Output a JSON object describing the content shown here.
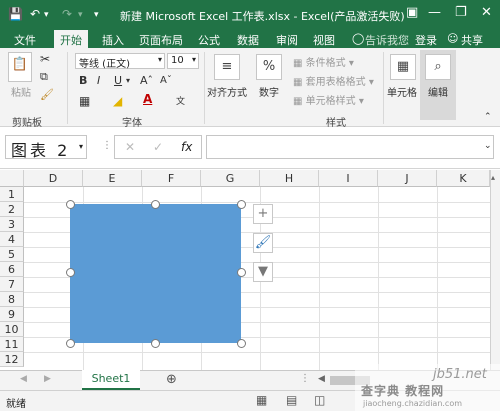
{
  "titlebar": {
    "title": "新建 Microsoft Excel 工作表.xlsx - Excel(产品激活失败)",
    "save_icon": "save-icon",
    "undo_icon": "undo-icon",
    "redo_icon": "redo-icon"
  },
  "tabs": {
    "file": "文件",
    "home": "开始",
    "insert": "插入",
    "page_layout": "页面布局",
    "formulas": "公式",
    "data": "数据",
    "review": "审阅",
    "view": "视图",
    "tell_me": "告诉我您",
    "login": "登录",
    "share": "共享"
  },
  "ribbon": {
    "paste_label": "粘贴",
    "clipboard_group": "剪贴板",
    "font_name": "等线 (正文)",
    "font_size": "10",
    "bold": "B",
    "italic": "I",
    "underline": "U",
    "font_group": "字体",
    "alignment_label": "对齐方式",
    "number_label": "数字",
    "conditional_format": "条件格式",
    "table_format": "套用表格格式",
    "cell_styles": "单元格样式",
    "styles_group": "样式",
    "cells_label": "单元格",
    "editing_label": "编辑"
  },
  "formula_bar": {
    "name_box": "图表 2",
    "fx": "fx",
    "formula_value": ""
  },
  "grid": {
    "columns": [
      "D",
      "E",
      "F",
      "G",
      "H",
      "I",
      "J",
      "K"
    ],
    "rows": [
      "1",
      "2",
      "3",
      "4",
      "5",
      "6",
      "7",
      "8",
      "9",
      "10",
      "11",
      "12"
    ]
  },
  "chart": {
    "fill_color": "#5b9bd5"
  },
  "sheet": {
    "active_tab": "Sheet1"
  },
  "status": {
    "ready": "就绪"
  },
  "watermark": {
    "site1": "jb51.net",
    "site2": "查字典 教程网",
    "site3": "jiaocheng.chazidian.com"
  },
  "colors": {
    "excel_green": "#217346",
    "ribbon_bg": "#f3f3f3"
  }
}
